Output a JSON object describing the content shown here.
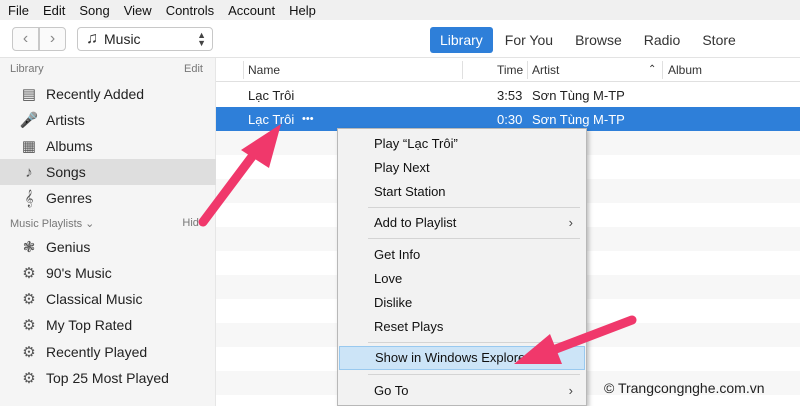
{
  "menu": [
    "File",
    "Edit",
    "Song",
    "View",
    "Controls",
    "Account",
    "Help"
  ],
  "toolbar": {
    "back_icon": "chevron-left-icon",
    "forward_icon": "chevron-right-icon",
    "media_kind": "Music",
    "tabs": [
      "Library",
      "For You",
      "Browse",
      "Radio",
      "Store"
    ],
    "active_tab": "Library"
  },
  "sidebar": {
    "library_header": "Library",
    "edit_label": "Edit",
    "library_items": [
      {
        "label": "Recently Added",
        "icon": "recently-added-icon"
      },
      {
        "label": "Artists",
        "icon": "microphone-icon"
      },
      {
        "label": "Albums",
        "icon": "album-icon"
      },
      {
        "label": "Songs",
        "icon": "music-note-icon"
      },
      {
        "label": "Genres",
        "icon": "genres-icon"
      }
    ],
    "selected_item": "Songs",
    "playlists_header": "Music Playlists",
    "hide_label": "Hide",
    "playlists": [
      {
        "label": "Genius",
        "icon": "genius-icon"
      },
      {
        "label": "90's Music",
        "icon": "gear-icon"
      },
      {
        "label": "Classical Music",
        "icon": "gear-icon"
      },
      {
        "label": "My Top Rated",
        "icon": "gear-icon"
      },
      {
        "label": "Recently Played",
        "icon": "gear-icon"
      },
      {
        "label": "Top 25 Most Played",
        "icon": "gear-icon"
      }
    ]
  },
  "table": {
    "columns": [
      "Name",
      "Time",
      "Artist",
      "Album"
    ],
    "rows": [
      {
        "name": "Lạc Trôi",
        "time": "3:53",
        "artist": "Sơn Tùng M-TP",
        "album": ""
      },
      {
        "name": "Lạc Trôi",
        "time": "0:30",
        "artist": "Sơn Tùng M-TP",
        "album": "",
        "more": "•••"
      }
    ]
  },
  "context_menu": {
    "items": [
      "Play “Lạc Trôi”",
      "Play Next",
      "Start Station",
      "Add to Playlist",
      "Get Info",
      "Love",
      "Dislike",
      "Reset Plays",
      "Show in Windows Explorer",
      "Go To"
    ],
    "highlighted": "Show in Windows Explorer",
    "submenu_glyph": "›"
  },
  "watermark": "© Trangcongnghe.com.vn",
  "colors": {
    "accent": "#2e7fd9",
    "arrow": "#f0386b",
    "highlight": "#cce4f7"
  }
}
